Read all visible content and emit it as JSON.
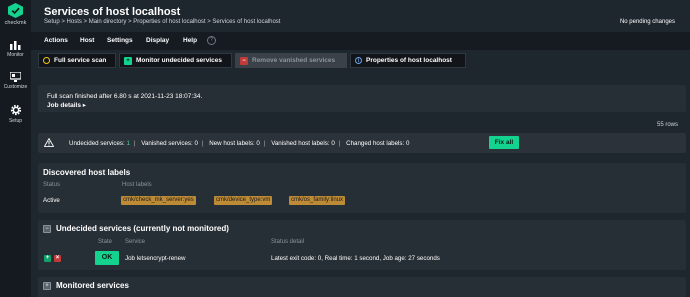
{
  "app": {
    "logo_text": "checkmk"
  },
  "sidebar": {
    "items": [
      {
        "label": "Monitor",
        "icon": "monitor-icon"
      },
      {
        "label": "Customize",
        "icon": "customize-icon"
      },
      {
        "label": "Setup",
        "icon": "setup-gear-icon"
      }
    ]
  },
  "header": {
    "title": "Services of host localhost",
    "breadcrumb": "Setup > Hosts > Main directory > Properties of host localhost > Services of host localhost",
    "pending": "No pending changes"
  },
  "menu": {
    "items": [
      "Actions",
      "Host",
      "Settings",
      "Display",
      "Help"
    ]
  },
  "actions": {
    "full_scan": "Full service scan",
    "monitor_undecided": "Monitor undecided services",
    "remove_vanished": "Remove vanished services",
    "properties": "Properties of host localhost"
  },
  "scan": {
    "message": "Full scan finished after 6.80 s at 2021-11-23 18:07:34.",
    "job_details": "Job details ▸"
  },
  "rows_count": "55 rows",
  "summary": {
    "undecided_label": "Undecided services:",
    "undecided_value": "1",
    "vanished_label": "Vanished services:",
    "vanished_value": "0",
    "new_labels_label": "New host labels:",
    "new_labels_value": "0",
    "vanished_labels_label": "Vanished host labels:",
    "vanished_labels_value": "0",
    "changed_labels_label": "Changed host labels:",
    "changed_labels_value": "0",
    "fix_all": "Fix all"
  },
  "host_labels": {
    "title": "Discovered host labels",
    "col_status": "Status",
    "col_labels": "Host labels",
    "status": "Active",
    "labels": [
      "cmk/check_mk_server:yes",
      "cmk/device_type:vm",
      "cmk/os_family:linux"
    ]
  },
  "undecided": {
    "title": "Undecided services (currently not monitored)",
    "col_state": "State",
    "col_service": "Service",
    "col_detail": "Status detail",
    "row": {
      "state": "OK",
      "service": "Job letsencrypt-renew",
      "detail": "Latest exit code: 0, Real time: 1 second, Job age: 27 seconds"
    }
  },
  "monitored": {
    "title": "Monitored services"
  },
  "colors": {
    "accent": "#13d38e",
    "label_chip": "#bd8a36",
    "panel": "#272f36",
    "background": "#1e262e"
  }
}
